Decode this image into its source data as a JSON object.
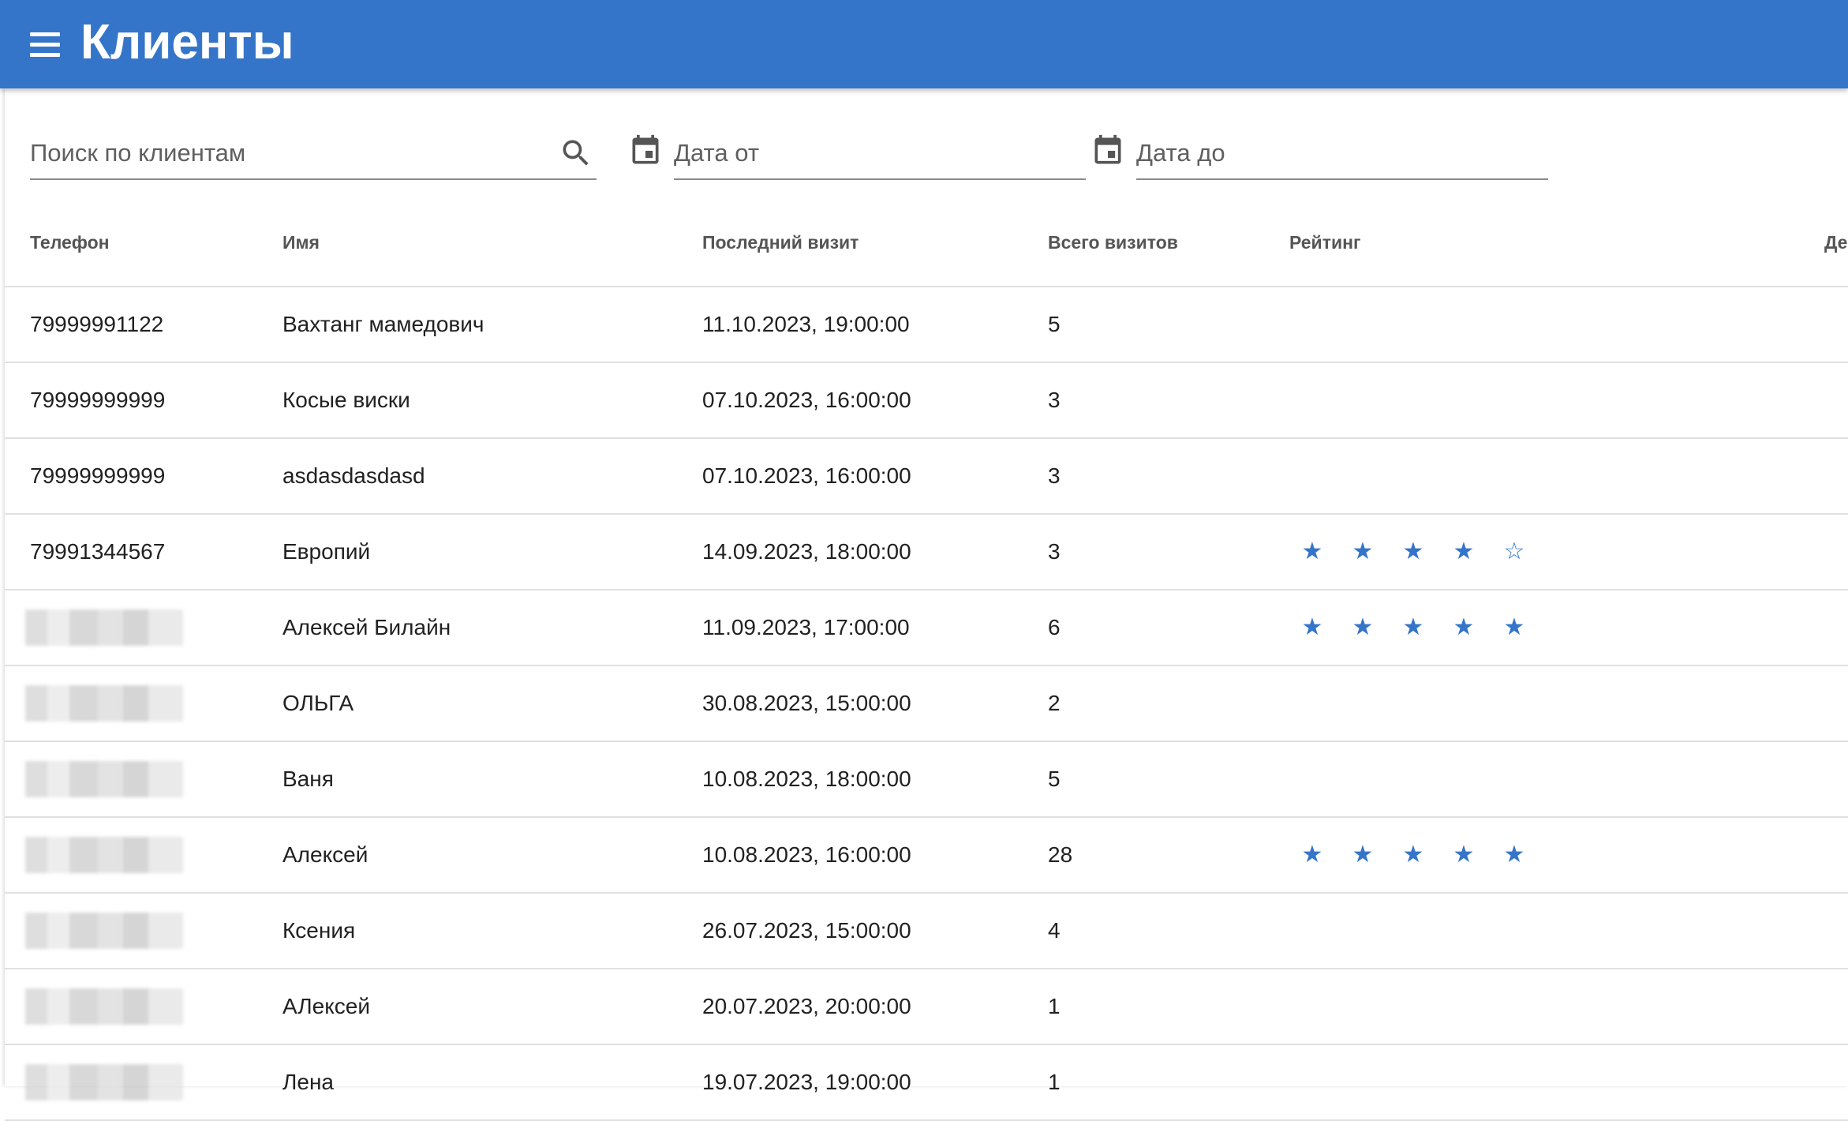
{
  "header": {
    "title": "Клиенты",
    "menu_icon": "hamburger-menu-icon",
    "color": "#3575C9"
  },
  "filters": {
    "search_placeholder": "Поиск по клиентам",
    "search_value": "",
    "date_from_placeholder": "Дата от",
    "date_from_value": "",
    "date_to_placeholder": "Дата до",
    "date_to_value": ""
  },
  "table": {
    "columns": [
      "Телефон",
      "Имя",
      "Последний визит",
      "Всего визитов",
      "Рейтинг",
      "Действия"
    ],
    "rows": [
      {
        "phone": "79999991122",
        "phone_hidden": false,
        "name": "Вахтанг мамедович",
        "last_visit": "11.10.2023, 19:00:00",
        "total": "5",
        "rating": 0
      },
      {
        "phone": "79999999999",
        "phone_hidden": false,
        "name": "Косые виски",
        "last_visit": "07.10.2023, 16:00:00",
        "total": "3",
        "rating": 0
      },
      {
        "phone": "79999999999",
        "phone_hidden": false,
        "name": "asdasdasdasd",
        "last_visit": "07.10.2023, 16:00:00",
        "total": "3",
        "rating": 0
      },
      {
        "phone": "79991344567",
        "phone_hidden": false,
        "name": "Европий",
        "last_visit": "14.09.2023, 18:00:00",
        "total": "3",
        "rating": 4
      },
      {
        "phone": "",
        "phone_hidden": true,
        "name": "Алексей Билайн",
        "last_visit": "11.09.2023, 17:00:00",
        "total": "6",
        "rating": 5
      },
      {
        "phone": "",
        "phone_hidden": true,
        "name": "ОЛЬГА",
        "last_visit": "30.08.2023, 15:00:00",
        "total": "2",
        "rating": 0
      },
      {
        "phone": "",
        "phone_hidden": true,
        "name": "Ваня",
        "last_visit": "10.08.2023, 18:00:00",
        "total": "5",
        "rating": 0
      },
      {
        "phone": "",
        "phone_hidden": true,
        "name": "Алексей",
        "last_visit": "10.08.2023, 16:00:00",
        "total": "28",
        "rating": 5
      },
      {
        "phone": "",
        "phone_hidden": true,
        "name": "Ксения",
        "last_visit": "26.07.2023, 15:00:00",
        "total": "4",
        "rating": 0
      },
      {
        "phone": "",
        "phone_hidden": true,
        "name": "АЛексей",
        "last_visit": "20.07.2023, 20:00:00",
        "total": "1",
        "rating": 0
      },
      {
        "phone": "",
        "phone_hidden": true,
        "name": "Лена",
        "last_visit": "19.07.2023, 19:00:00",
        "total": "1",
        "rating": 0
      }
    ],
    "rating_max": 5,
    "action_icon": "view-client-details-icon"
  }
}
